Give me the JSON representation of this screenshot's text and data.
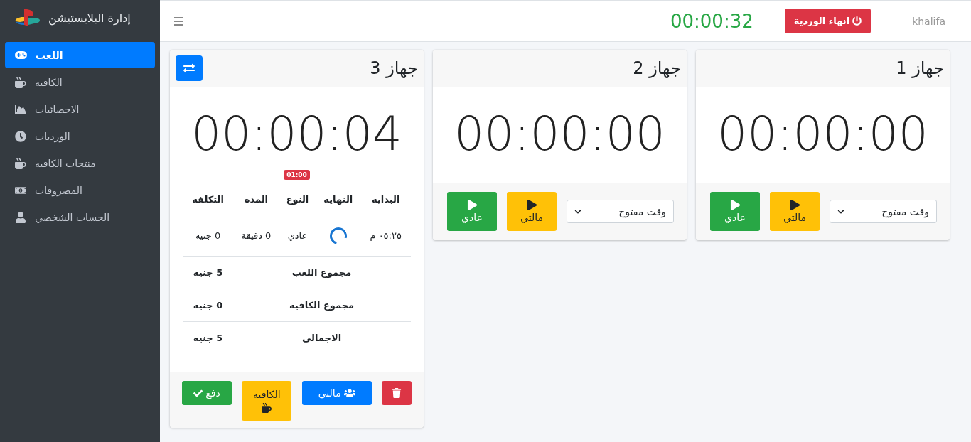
{
  "sidebar": {
    "title": "إدارة البلايستيشن",
    "items": [
      {
        "label": "اللعب",
        "selected": true
      },
      {
        "label": "الكافيه",
        "selected": false
      },
      {
        "label": "الاحصائيات",
        "selected": false
      },
      {
        "label": "الورديات",
        "selected": false
      },
      {
        "label": "منتجات الكافيه",
        "selected": false
      },
      {
        "label": "المصروفات",
        "selected": false
      },
      {
        "label": "الحساب الشخصي",
        "selected": false
      }
    ]
  },
  "header": {
    "shift_timer": "00:00:32",
    "end_shift_button": "انهاء الوردية",
    "username": "khalifa"
  },
  "devices": [
    {
      "kind": "idle",
      "title": "جهاز 1",
      "timer": "00:00:00",
      "mode_select": "وقت مفتوح",
      "buttons": [
        {
          "label": "مالتي",
          "kind": "multi"
        },
        {
          "label": "عادي",
          "kind": "normal"
        }
      ]
    },
    {
      "kind": "idle",
      "title": "جهاز 2",
      "timer": "00:00:00",
      "mode_select": "وقت مفتوح",
      "buttons": [
        {
          "label": "مالتي",
          "kind": "multi"
        },
        {
          "label": "عادي",
          "kind": "normal"
        }
      ]
    },
    {
      "kind": "active",
      "title": "جهاز 3",
      "timer": "00:00:04",
      "badge": "01:00",
      "table": {
        "columns": [
          "البداية",
          "النهاية",
          "النوع",
          "المدة",
          "التكلفة"
        ],
        "rows": [
          {
            "start": "٠٥:٢٥ م",
            "end_running": true,
            "type": "عادي",
            "duration": "0 دقيقة",
            "cost": "0 جنيه"
          }
        ],
        "totals": [
          {
            "label": "مجموع اللعب",
            "value": "5 جنيه"
          },
          {
            "label": "مجموع الكافيه",
            "value": "0 جنيه"
          },
          {
            "label": "الاجمالي",
            "value": "5 جنيه"
          }
        ]
      },
      "actions": [
        {
          "kind": "delete"
        },
        {
          "kind": "multi",
          "label": "مالتى"
        },
        {
          "kind": "cafe",
          "label": "الكافيه"
        },
        {
          "kind": "pay",
          "label": "دفع"
        }
      ]
    }
  ]
}
